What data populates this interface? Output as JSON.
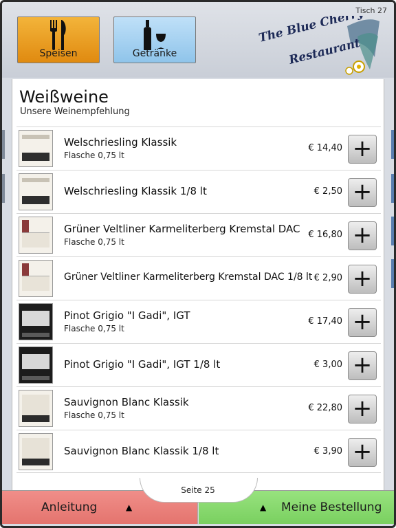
{
  "header": {
    "table": "Tisch 27",
    "categories": [
      {
        "label": "Speisen",
        "icon": "cutlery-icon"
      },
      {
        "label": "Getränke",
        "icon": "wine-bottle-glass-icon"
      }
    ],
    "logo_text": [
      "The Blue Cherry",
      "Restaurant"
    ]
  },
  "section": {
    "title": "Weißweine",
    "subtitle": "Unsere Weinempfehlung"
  },
  "items": [
    {
      "name": "Welschriesling Klassik",
      "size": "Flasche 0,75 lt",
      "price": "€ 14,40",
      "label": "white"
    },
    {
      "name": "Welschriesling Klassik 1/8 lt",
      "size": "",
      "price": "€ 2,50",
      "label": "white"
    },
    {
      "name": "Grüner Veltliner Karmeliterberg Kremstal DAC",
      "size": "Flasche 0,75 lt",
      "price": "€ 16,80",
      "label": "moser"
    },
    {
      "name": "Grüner Veltliner Karmeliterberg Kremstal DAC 1/8 lt",
      "size": "",
      "price": "€ 2,90",
      "label": "moser"
    },
    {
      "name": "Pinot Grigio \"I Gadi\", IGT",
      "size": "Flasche 0,75 lt",
      "price": "€ 17,40",
      "label": "dark"
    },
    {
      "name": "Pinot Grigio \"I Gadi\", IGT 1/8 lt",
      "size": "",
      "price": "€ 3,00",
      "label": "dark"
    },
    {
      "name": "Sauvignon Blanc Klassik",
      "size": "Flasche 0,75 lt",
      "price": "€ 22,80",
      "label": "sb"
    },
    {
      "name": "Sauvignon Blanc Klassik 1/8 lt",
      "size": "",
      "price": "€ 3,90",
      "label": "sb"
    }
  ],
  "add_symbol": "+",
  "footer": {
    "page": "Seite 25",
    "left_button": "Anleitung",
    "right_button": "Meine Bestellung",
    "arrow": "▲"
  },
  "colors": {
    "speisen": "#e89a1c",
    "getraenke": "#a9d3f2",
    "anleitung": "#e97f79",
    "bestellung": "#86d86b"
  }
}
